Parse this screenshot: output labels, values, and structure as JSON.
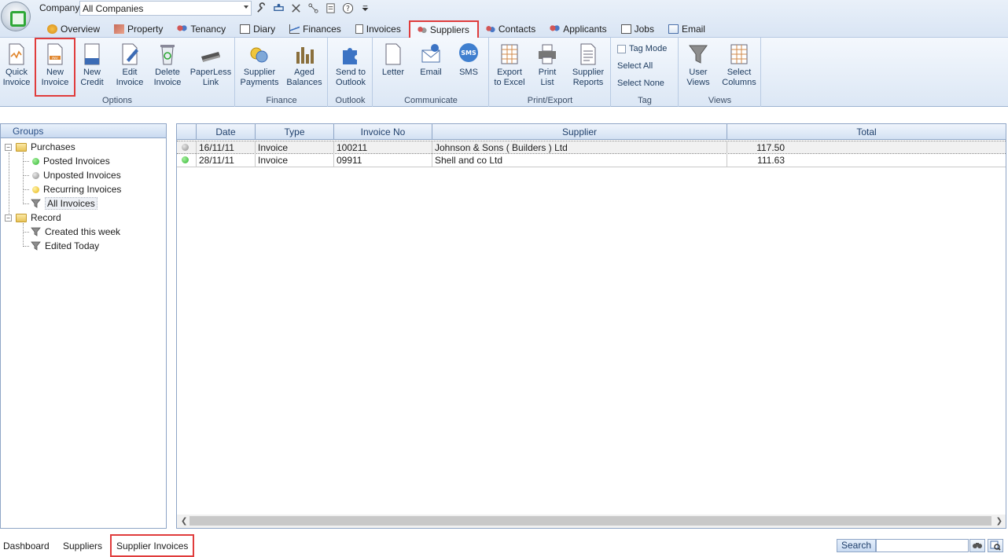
{
  "app": {
    "company_label": "Company",
    "company_value": "All Companies"
  },
  "quick_access": [
    "wrench-icon",
    "link-icon",
    "tools-icon",
    "network-icon",
    "document-icon",
    "help-icon",
    "customize-dropdown-icon"
  ],
  "tabs": [
    {
      "label": "Overview",
      "icon": "overview-icon",
      "active": false
    },
    {
      "label": "Property",
      "icon": "house-icon",
      "active": false
    },
    {
      "label": "Tenancy",
      "icon": "people-icon",
      "active": false
    },
    {
      "label": "Diary",
      "icon": "calendar-icon",
      "active": false
    },
    {
      "label": "Finances",
      "icon": "chart-icon",
      "active": false
    },
    {
      "label": "Invoices",
      "icon": "invoice-icon",
      "active": false
    },
    {
      "label": "Suppliers",
      "icon": "supplier-icon",
      "active": true
    },
    {
      "label": "Contacts",
      "icon": "contacts-icon",
      "active": false
    },
    {
      "label": "Applicants",
      "icon": "applicants-icon",
      "active": false
    },
    {
      "label": "Jobs",
      "icon": "jobs-icon",
      "active": false
    },
    {
      "label": "Email",
      "icon": "email-icon",
      "active": false
    }
  ],
  "ribbon": {
    "options": {
      "label": "Options",
      "buttons": [
        {
          "label": "Quick\nInvoice",
          "icon": "quick-invoice-icon"
        },
        {
          "label": "New\nInvoice",
          "icon": "new-invoice-icon"
        },
        {
          "label": "New\nCredit",
          "icon": "new-credit-icon"
        },
        {
          "label": "Edit\nInvoice",
          "icon": "edit-invoice-icon"
        },
        {
          "label": "Delete\nInvoice",
          "icon": "delete-invoice-icon"
        },
        {
          "label": "PaperLess\nLink",
          "icon": "scanner-icon"
        }
      ]
    },
    "finance": {
      "label": "Finance",
      "buttons": [
        {
          "label": "Supplier\nPayments",
          "icon": "coins-icon"
        },
        {
          "label": "Aged\nBalances",
          "icon": "bar-chart-icon"
        }
      ]
    },
    "outlook": {
      "label": "Outlook",
      "buttons": [
        {
          "label": "Send to\nOutlook",
          "icon": "puzzle-icon"
        }
      ]
    },
    "communicate": {
      "label": "Communicate",
      "buttons": [
        {
          "label": "Letter",
          "icon": "letter-icon"
        },
        {
          "label": "Email",
          "icon": "email-icon"
        },
        {
          "label": "SMS",
          "icon": "sms-icon"
        }
      ]
    },
    "print_export": {
      "label": "Print/Export",
      "buttons": [
        {
          "label": "Export\nto Excel",
          "icon": "excel-icon"
        },
        {
          "label": "Print\nList",
          "icon": "printer-icon"
        },
        {
          "label": "Supplier\nReports",
          "icon": "report-icon"
        }
      ]
    },
    "tag": {
      "label": "Tag",
      "tag_mode": "Tag Mode",
      "select_all": "Select All",
      "select_none": "Select None"
    },
    "views": {
      "label": "Views",
      "buttons": [
        {
          "label": "User\nViews",
          "icon": "filter-icon"
        },
        {
          "label": "Select\nColumns",
          "icon": "columns-icon"
        }
      ]
    }
  },
  "groups": {
    "header": "Groups",
    "purchases": {
      "label": "Purchases",
      "items": [
        {
          "label": "Posted Invoices",
          "icon": "green-dot-icon"
        },
        {
          "label": "Unposted Invoices",
          "icon": "grey-dot-icon"
        },
        {
          "label": "Recurring Invoices",
          "icon": "yellow-dot-icon"
        },
        {
          "label": "All Invoices",
          "icon": "filter-icon"
        }
      ]
    },
    "record": {
      "label": "Record",
      "items": [
        {
          "label": "Created this week",
          "icon": "filter-icon"
        },
        {
          "label": "Edited Today",
          "icon": "filter-icon"
        }
      ]
    }
  },
  "grid": {
    "columns": [
      "Date",
      "Type",
      "Invoice No",
      "Supplier",
      "Total"
    ],
    "rows": [
      {
        "status": "grey",
        "date": "16/11/11",
        "type": "Invoice",
        "invoice_no": "100211",
        "supplier": "Johnson & Sons ( Builders ) Ltd",
        "total": "117.50"
      },
      {
        "status": "green",
        "date": "28/11/11",
        "type": "Invoice",
        "invoice_no": "09911",
        "supplier": "Shell and co Ltd",
        "total": "111.63"
      }
    ]
  },
  "bottom": {
    "tabs": [
      "Dashboard",
      "Suppliers",
      "Supplier Invoices"
    ],
    "search_label": "Search",
    "search_value": ""
  },
  "colors": {
    "highlight": "#e03c3c",
    "posted": "#3cc23c",
    "unposted": "#9a9a9a",
    "recurring": "#f2c21a",
    "header_text": "#2a4f86"
  }
}
